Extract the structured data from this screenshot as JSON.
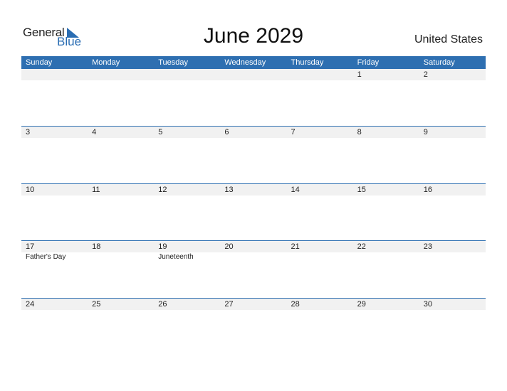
{
  "logo": {
    "line1": "General",
    "line2": "Blue"
  },
  "title": "June 2029",
  "country": "United States",
  "weekdays": [
    "Sunday",
    "Monday",
    "Tuesday",
    "Wednesday",
    "Thursday",
    "Friday",
    "Saturday"
  ],
  "weeks": [
    {
      "days": [
        "",
        "",
        "",
        "",
        "",
        "1",
        "2"
      ],
      "events": [
        "",
        "",
        "",
        "",
        "",
        "",
        ""
      ]
    },
    {
      "days": [
        "3",
        "4",
        "5",
        "6",
        "7",
        "8",
        "9"
      ],
      "events": [
        "",
        "",
        "",
        "",
        "",
        "",
        ""
      ]
    },
    {
      "days": [
        "10",
        "11",
        "12",
        "13",
        "14",
        "15",
        "16"
      ],
      "events": [
        "",
        "",
        "",
        "",
        "",
        "",
        ""
      ]
    },
    {
      "days": [
        "17",
        "18",
        "19",
        "20",
        "21",
        "22",
        "23"
      ],
      "events": [
        "Father's Day",
        "",
        "Juneteenth",
        "",
        "",
        "",
        ""
      ]
    },
    {
      "days": [
        "24",
        "25",
        "26",
        "27",
        "28",
        "29",
        "30"
      ],
      "events": [
        "",
        "",
        "",
        "",
        "",
        "",
        ""
      ]
    }
  ],
  "colors": {
    "accent": "#2e6fb1",
    "row_bg": "#f1f1f1"
  }
}
